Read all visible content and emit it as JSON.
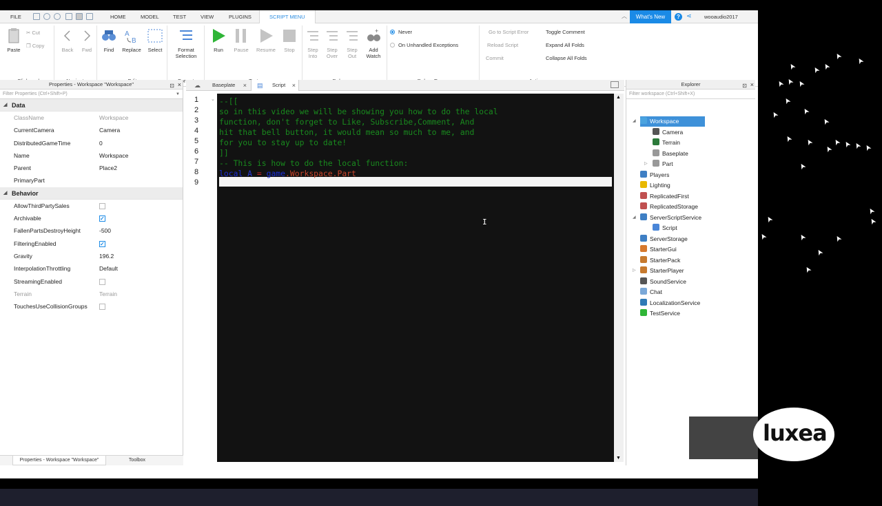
{
  "menubar": {
    "file": "FILE",
    "tabs": [
      "HOME",
      "MODEL",
      "TEST",
      "VIEW",
      "PLUGINS",
      "SCRIPT MENU"
    ],
    "whats_new": "What's New",
    "username": "wooaudio2017"
  },
  "ribbon": {
    "clipboard": {
      "paste": "Paste",
      "cut": "Cut",
      "copy": "Copy",
      "label": "Clipboard"
    },
    "navigate": {
      "back": "Back",
      "fwd": "Fwd",
      "label": "Navigate"
    },
    "edit": {
      "find": "Find",
      "replace": "Replace",
      "select": "Select",
      "label": "Edit"
    },
    "format": {
      "line1": "Format",
      "line2": "Selection",
      "label": "Format"
    },
    "test": {
      "run": "Run",
      "pause": "Pause",
      "resume": "Resume",
      "stop": "Stop",
      "label": "Test"
    },
    "debugger": {
      "step_into_1": "Step",
      "step_into_2": "Into",
      "step_over_1": "Step",
      "step_over_2": "Over",
      "step_out_1": "Step",
      "step_out_2": "Out",
      "add_watch_1": "Add",
      "add_watch_2": "Watch",
      "label": "Debugger"
    },
    "debug_errors": {
      "never": "Never",
      "on_unhandled": "On Unhandled Exceptions",
      "label": "Debug Errors"
    },
    "actions": {
      "go_to_error": "Go to Script Error",
      "reload": "Reload Script",
      "commit": "Commit",
      "toggle_comment": "Toggle Comment",
      "expand_all": "Expand All Folds",
      "collapse_all": "Collapse All Folds",
      "label": "Actions"
    }
  },
  "properties": {
    "title": "Properties - Workspace \"Workspace\"",
    "filter_placeholder": "Filter Properties (Ctrl+Shift+P)",
    "sections": {
      "data": "Data",
      "behavior": "Behavior"
    },
    "data_rows": [
      {
        "k": "ClassName",
        "v": "Workspace"
      },
      {
        "k": "CurrentCamera",
        "v": "Camera"
      },
      {
        "k": "DistributedGameTime",
        "v": "0"
      },
      {
        "k": "Name",
        "v": "Workspace"
      },
      {
        "k": "Parent",
        "v": "Place2"
      },
      {
        "k": "PrimaryPart",
        "v": ""
      }
    ],
    "behavior_rows": [
      {
        "k": "AllowThirdPartySales",
        "checked": false
      },
      {
        "k": "Archivable",
        "checked": true
      },
      {
        "k": "FallenPartsDestroyHeight",
        "v": "-500"
      },
      {
        "k": "FilteringEnabled",
        "checked": true
      },
      {
        "k": "Gravity",
        "v": "196.2"
      },
      {
        "k": "InterpolationThrottling",
        "v": "Default"
      },
      {
        "k": "StreamingEnabled",
        "checked": false
      },
      {
        "k": "Terrain",
        "v": "Terrain"
      },
      {
        "k": "TouchesUseCollisionGroups",
        "checked": false
      }
    ],
    "bottom_tabs": [
      "Properties - Workspace \"Workspace\"",
      "Toolbox"
    ]
  },
  "editor": {
    "tabs": [
      "Baseplate",
      "Script"
    ],
    "line_numbers": [
      "1",
      "2",
      "3",
      "4",
      "5",
      "6",
      "7",
      "8",
      "9"
    ],
    "lines": [
      "--[[",
      "so in this video we will be showing you how to do the local",
      "function, don't forget to Like, Subscribe,Comment, And",
      "hit that bell button, it would mean so much to me, and",
      "for you to stay up to date!",
      "]]",
      "-- This is how to do the local function:",
      "",
      ""
    ],
    "line8": {
      "kw": "local",
      "var": "A",
      "eq": "=",
      "game": "game",
      "rest": ".Workspace.Part"
    }
  },
  "explorer": {
    "title": "Explorer",
    "filter_placeholder": "Filter workspace (Ctrl+Shift+X)",
    "items": [
      {
        "label": "Workspace",
        "icon": "workspace-icon"
      },
      {
        "label": "Camera",
        "icon": "camera-icon"
      },
      {
        "label": "Terrain",
        "icon": "terrain-icon"
      },
      {
        "label": "Baseplate",
        "icon": "part-icon"
      },
      {
        "label": "Part",
        "icon": "part-icon"
      },
      {
        "label": "Players",
        "icon": "players-icon"
      },
      {
        "label": "Lighting",
        "icon": "lighting-icon"
      },
      {
        "label": "ReplicatedFirst",
        "icon": "replicated-first-icon"
      },
      {
        "label": "ReplicatedStorage",
        "icon": "replicated-storage-icon"
      },
      {
        "label": "ServerScriptService",
        "icon": "server-script-service-icon"
      },
      {
        "label": "Script",
        "icon": "script-icon"
      },
      {
        "label": "ServerStorage",
        "icon": "server-storage-icon"
      },
      {
        "label": "StarterGui",
        "icon": "starter-gui-icon"
      },
      {
        "label": "StarterPack",
        "icon": "starter-pack-icon"
      },
      {
        "label": "StarterPlayer",
        "icon": "starter-player-icon"
      },
      {
        "label": "SoundService",
        "icon": "sound-service-icon"
      },
      {
        "label": "Chat",
        "icon": "chat-icon"
      },
      {
        "label": "LocalizationService",
        "icon": "localization-service-icon"
      },
      {
        "label": "TestService",
        "icon": "test-service-icon"
      }
    ]
  },
  "watermark": {
    "text": "luxea"
  },
  "colors": {
    "accent": "#1a8ae6",
    "code_bg": "#121212",
    "comment": "#198a1e",
    "keyword": "#1c2fd6",
    "selected": "#3e91d9"
  }
}
